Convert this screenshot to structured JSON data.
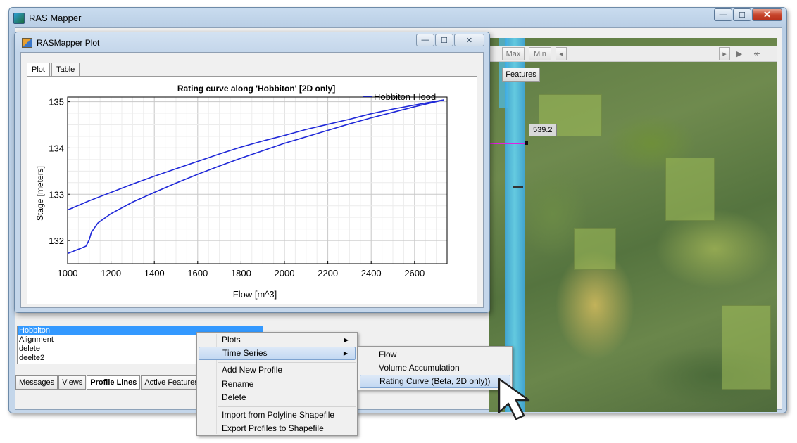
{
  "app": {
    "title": "RAS Mapper"
  },
  "window_controls": {
    "minimize": "—",
    "maximize": "☐",
    "close": "✕"
  },
  "map": {
    "toolbar": {
      "max_label": "Max",
      "min_label": "Min",
      "prev": "◂",
      "next": "▸",
      "play": "▶",
      "other": "↞"
    },
    "features_label": "Features",
    "value_label": "539.2"
  },
  "plot_window": {
    "title": "RASMapper Plot",
    "tabs": [
      {
        "label": "Plot"
      },
      {
        "label": "Table"
      }
    ]
  },
  "chart_data": {
    "type": "line",
    "title": "Rating curve along 'Hobbiton' [2D only]",
    "xlabel": "Flow [m^3]",
    "ylabel": "Stage [meters]",
    "xlim": [
      1000,
      2750
    ],
    "ylim": [
      131.5,
      135.1
    ],
    "xticks": [
      1000,
      1200,
      1400,
      1600,
      1800,
      2000,
      2200,
      2400,
      2600
    ],
    "yticks": [
      132,
      133,
      134,
      135
    ],
    "grid": true,
    "legend_position": "top-right",
    "series": [
      {
        "name": "Hobbiton Flood",
        "color": "#1f28d8",
        "points": [
          [
            1000,
            131.72
          ],
          [
            1060,
            131.83
          ],
          [
            1085,
            131.88
          ],
          [
            1100,
            132.02
          ],
          [
            1110,
            132.18
          ],
          [
            1140,
            132.38
          ],
          [
            1200,
            132.58
          ],
          [
            1300,
            132.83
          ],
          [
            1400,
            133.04
          ],
          [
            1500,
            133.24
          ],
          [
            1600,
            133.43
          ],
          [
            1700,
            133.61
          ],
          [
            1800,
            133.78
          ],
          [
            1900,
            133.94
          ],
          [
            2000,
            134.1
          ],
          [
            2100,
            134.24
          ],
          [
            2200,
            134.38
          ],
          [
            2300,
            134.52
          ],
          [
            2400,
            134.65
          ],
          [
            2500,
            134.77
          ],
          [
            2600,
            134.89
          ],
          [
            2700,
            135.0
          ],
          [
            2735,
            135.04
          ],
          [
            2650,
            134.97
          ],
          [
            2500,
            134.84
          ],
          [
            2400,
            134.74
          ],
          [
            2300,
            134.62
          ],
          [
            2200,
            134.51
          ],
          [
            2100,
            134.4
          ],
          [
            2000,
            134.27
          ],
          [
            1900,
            134.15
          ],
          [
            1800,
            134.02
          ],
          [
            1700,
            133.87
          ],
          [
            1600,
            133.71
          ],
          [
            1500,
            133.55
          ],
          [
            1400,
            133.39
          ],
          [
            1300,
            133.22
          ],
          [
            1200,
            133.04
          ],
          [
            1100,
            132.86
          ],
          [
            1000,
            132.66
          ]
        ]
      }
    ]
  },
  "profile_list": {
    "items": [
      {
        "label": "Hobbiton",
        "selected": true
      },
      {
        "label": "Alignment",
        "selected": false
      },
      {
        "label": "delete",
        "selected": false
      },
      {
        "label": "deelte2",
        "selected": false
      }
    ]
  },
  "bottom_tabs": [
    {
      "label": "Messages",
      "active": false
    },
    {
      "label": "Views",
      "active": false
    },
    {
      "label": "Profile Lines",
      "active": true
    },
    {
      "label": "Active Features",
      "active": false
    }
  ],
  "context_menu": {
    "items": [
      {
        "label": "Plots",
        "has_submenu": true
      },
      {
        "label": "Time Series",
        "has_submenu": true,
        "highlighted": true
      },
      {
        "label": "Add New Profile"
      },
      {
        "label": "Rename"
      },
      {
        "label": "Delete"
      },
      {
        "label": "Import from Polyline Shapefile"
      },
      {
        "label": "Export Profiles to Shapefile"
      }
    ],
    "submenu": [
      {
        "label": "Flow"
      },
      {
        "label": "Volume Accumulation"
      },
      {
        "label": "Rating Curve (Beta, 2D only))",
        "highlighted": true
      }
    ]
  }
}
